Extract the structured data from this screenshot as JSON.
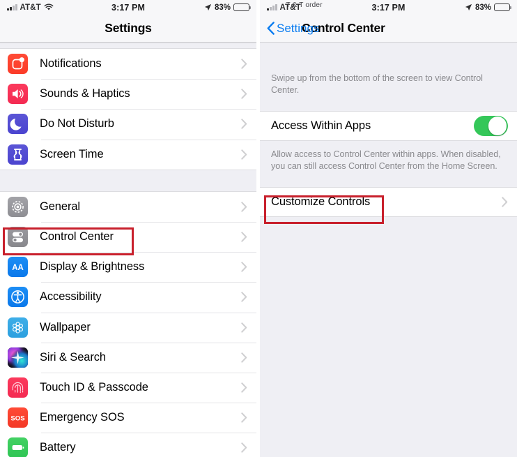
{
  "left_panel": {
    "status_bar": {
      "carrier": "AT&T",
      "time": "3:17 PM",
      "battery_percent": "83%",
      "signal_icon": "cellular-signal-icon",
      "wifi_icon": "wifi-icon",
      "location_icon": "location-arrow-icon",
      "battery_icon": "battery-icon"
    },
    "nav": {
      "title": "Settings"
    },
    "groups": [
      {
        "items": [
          {
            "label": "Notifications",
            "icon": "notifications-icon",
            "chevron": "chevron-right-icon"
          },
          {
            "label": "Sounds & Haptics",
            "icon": "sounds-icon",
            "chevron": "chevron-right-icon"
          },
          {
            "label": "Do Not Disturb",
            "icon": "do-not-disturb-icon",
            "chevron": "chevron-right-icon"
          },
          {
            "label": "Screen Time",
            "icon": "screen-time-icon",
            "chevron": "chevron-right-icon"
          }
        ]
      },
      {
        "items": [
          {
            "label": "General",
            "icon": "general-gear-icon",
            "chevron": "chevron-right-icon"
          },
          {
            "label": "Control Center",
            "icon": "control-center-icon",
            "chevron": "chevron-right-icon"
          },
          {
            "label": "Display & Brightness",
            "icon": "display-brightness-icon",
            "chevron": "chevron-right-icon"
          },
          {
            "label": "Accessibility",
            "icon": "accessibility-icon",
            "chevron": "chevron-right-icon"
          },
          {
            "label": "Wallpaper",
            "icon": "wallpaper-icon",
            "chevron": "chevron-right-icon"
          },
          {
            "label": "Siri & Search",
            "icon": "siri-icon",
            "chevron": "chevron-right-icon"
          },
          {
            "label": "Touch ID & Passcode",
            "icon": "touch-id-icon",
            "chevron": "chevron-right-icon"
          },
          {
            "label": "Emergency SOS",
            "icon": "emergency-sos-icon",
            "chevron": "chevron-right-icon"
          },
          {
            "label": "Battery",
            "icon": "battery-settings-icon",
            "chevron": "chevron-right-icon"
          }
        ]
      }
    ]
  },
  "right_panel": {
    "status_bar": {
      "carrier": "AT&T",
      "carrier_overlay": "T & T order",
      "time": "3:17 PM",
      "battery_percent": "83%",
      "signal_icon": "cellular-signal-icon",
      "location_icon": "location-arrow-icon",
      "battery_icon": "battery-icon"
    },
    "nav": {
      "back_label": "Settings",
      "back_icon": "chevron-left-icon",
      "title": "Control Center"
    },
    "footnote_top": "Swipe up from the bottom of the screen to view Control Center.",
    "toggle": {
      "label": "Access Within Apps",
      "state": "on",
      "color": "#34c759"
    },
    "footnote_bottom": "Allow access to Control Center within apps. When disabled, you can still access Control Center from the Home Screen.",
    "customize_row": {
      "label": "Customize Controls",
      "chevron": "chevron-right-icon"
    }
  },
  "annotations": {
    "color": "#c8202c",
    "boxes": [
      {
        "name": "control-center-highlight",
        "target": "Control Center"
      },
      {
        "name": "customize-controls-highlight",
        "target": "Customize Controls"
      }
    ]
  }
}
